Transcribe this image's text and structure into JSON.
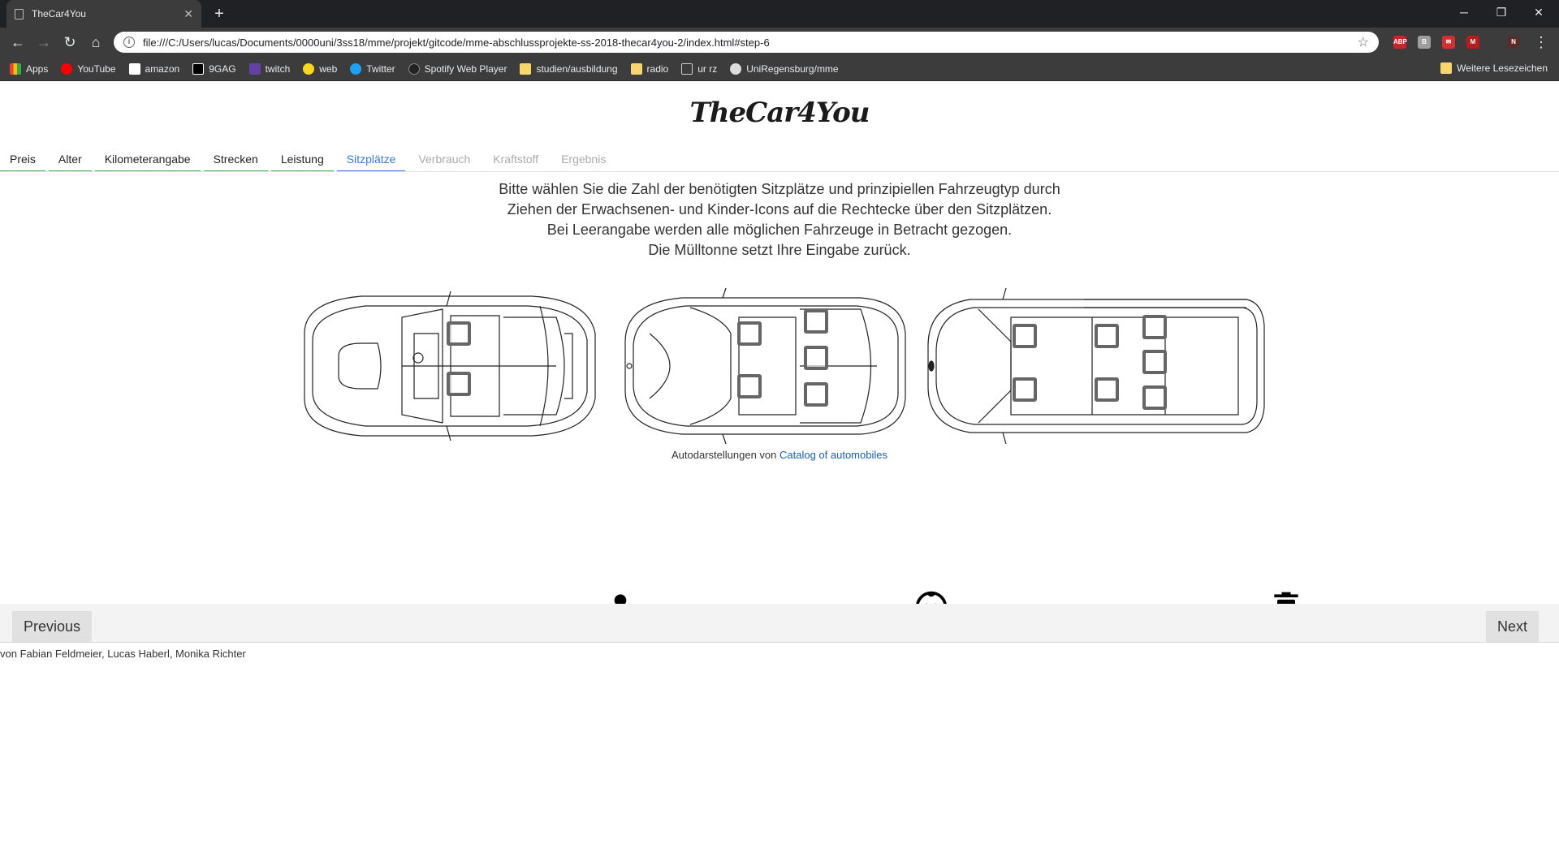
{
  "browser": {
    "tab_title": "TheCar4You",
    "url": "file:///C:/Users/lucas/Documents/0000uni/3ss18/mme/projekt/gitcode/mme-abschlussprojekte-ss-2018-thecar4you-2/index.html#step-6",
    "bookmarks": [
      "Apps",
      "YouTube",
      "amazon",
      "9GAG",
      "twitch",
      "web",
      "Twitter",
      "Spotify Web Player",
      "studien/ausbildung",
      "radio",
      "ur rz",
      "UniRegensburg/mme"
    ],
    "other_bookmarks": "Weitere Lesezeichen",
    "profile_initial": "N"
  },
  "site": {
    "logo": "TheCar4You"
  },
  "steps": [
    {
      "label": "Preis",
      "state": "done"
    },
    {
      "label": "Alter",
      "state": "done"
    },
    {
      "label": "Kilometerangabe",
      "state": "done"
    },
    {
      "label": "Strecken",
      "state": "done"
    },
    {
      "label": "Leistung",
      "state": "done"
    },
    {
      "label": "Sitzplätze",
      "state": "active"
    },
    {
      "label": "Verbrauch",
      "state": "disabled"
    },
    {
      "label": "Kraftstoff",
      "state": "disabled"
    },
    {
      "label": "Ergebnis",
      "state": "disabled"
    }
  ],
  "instructions": {
    "line1": "Bitte wählen Sie die Zahl der benötigten Sitzplätze und prinzipiellen Fahrzeugtyp durch",
    "line2": "Ziehen der Erwachsenen- und Kinder-Icons auf die Rechtecke über den Sitzplätzen.",
    "line3": "Bei Leerangabe werden alle möglichen Fahrzeuge in Betracht gezogen.",
    "line4": "Die Mülltonne setzt Ihre Eingabe zurück."
  },
  "credits": {
    "prefix": "Autodarstellungen von",
    "link": "Catalog of automobiles"
  },
  "icons": {
    "adult": "person-icon",
    "child": "child-face-icon",
    "reset": "trash-icon"
  },
  "nav": {
    "previous": "Previous",
    "next": "Next"
  },
  "footer": {
    "authors": "von Fabian Feldmeier, Lucas Haberl, Monika Richter"
  },
  "colors": {
    "active_step": "#3a7bd5",
    "done_step": "#4caf50",
    "link": "#1a5fb4"
  }
}
